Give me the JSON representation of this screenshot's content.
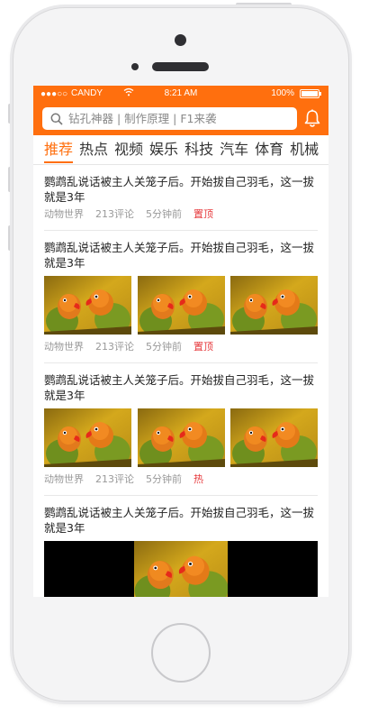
{
  "status_bar": {
    "signal": "●●●○○",
    "carrier": "CANDY",
    "time": "8:21 AM",
    "battery": "100%"
  },
  "header": {
    "search_placeholder": "钻孔神器 | 制作原理 | F1来袭",
    "accent_color": "#ff6f0e"
  },
  "tabs": [
    "推荐",
    "热点",
    "视频",
    "娱乐",
    "科技",
    "汽车",
    "体育",
    "机械"
  ],
  "articles": [
    {
      "title": "鹦鹉乱说话被主人关笼子后。开始拔自己羽毛，这一拔就是3年",
      "source": "动物世界",
      "comments": "213评论",
      "time": "5分钟前",
      "tag": "置顶",
      "layout": "text"
    },
    {
      "title": "鹦鹉乱说话被主人关笼子后。开始拔自己羽毛，这一拔就是3年",
      "source": "动物世界",
      "comments": "213评论",
      "time": "5分钟前",
      "tag": "置顶",
      "layout": "three-images"
    },
    {
      "title": "鹦鹉乱说话被主人关笼子后。开始拔自己羽毛，这一拔就是3年",
      "source": "动物世界",
      "comments": "213评论",
      "time": "5分钟前",
      "tag": "热",
      "layout": "three-images"
    },
    {
      "title": "鹦鹉乱说话被主人关笼子后。开始拔自己羽毛，这一拔就是3年",
      "layout": "video"
    }
  ]
}
